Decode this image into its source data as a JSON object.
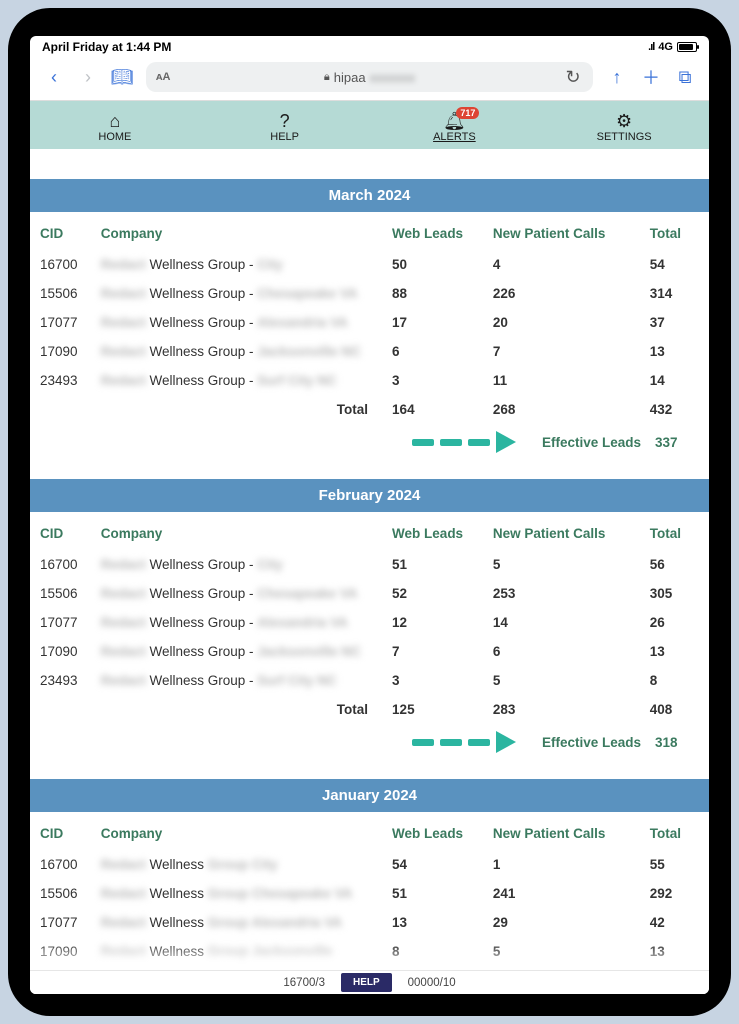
{
  "status": {
    "time": "April Friday at 1:44 PM",
    "carrier": "4G"
  },
  "browser": {
    "domain_visible": "hipaa",
    "domain_blur": "xxxxxxx"
  },
  "nav": {
    "home": "HOME",
    "help": "HELP",
    "alerts": "ALERTS",
    "alerts_badge": "717",
    "settings": "SETTINGS"
  },
  "columns": {
    "cid": "CID",
    "company": "Company",
    "web_leads": "Web Leads",
    "new_patient_calls": "New Patient Calls",
    "total": "Total"
  },
  "labels": {
    "total": "Total",
    "effective": "Effective Leads"
  },
  "months": [
    {
      "title": "March 2024",
      "rows": [
        {
          "cid": "16700",
          "company_blur": "Redact",
          "company": "Wellness Group -",
          "suffix_blur": "City",
          "wl": "50",
          "npc": "4",
          "tot": "54"
        },
        {
          "cid": "15506",
          "company_blur": "Redact",
          "company": "Wellness Group -",
          "suffix_blur": "Chesapeake VA",
          "wl": "88",
          "npc": "226",
          "tot": "314"
        },
        {
          "cid": "17077",
          "company_blur": "Redact",
          "company": "Wellness Group -",
          "suffix_blur": "Alexandria VA",
          "wl": "17",
          "npc": "20",
          "tot": "37"
        },
        {
          "cid": "17090",
          "company_blur": "Redact",
          "company": "Wellness Group -",
          "suffix_blur": "Jacksonville NC",
          "wl": "6",
          "npc": "7",
          "tot": "13"
        },
        {
          "cid": "23493",
          "company_blur": "Redact",
          "company": "Wellness Group -",
          "suffix_blur": "Surf City NC",
          "wl": "3",
          "npc": "11",
          "tot": "14"
        }
      ],
      "totals": {
        "wl": "164",
        "npc": "268",
        "tot": "432"
      },
      "effective": "337"
    },
    {
      "title": "February 2024",
      "rows": [
        {
          "cid": "16700",
          "company_blur": "Redact",
          "company": "Wellness Group -",
          "suffix_blur": "City",
          "wl": "51",
          "npc": "5",
          "tot": "56"
        },
        {
          "cid": "15506",
          "company_blur": "Redact",
          "company": "Wellness Group -",
          "suffix_blur": "Chesapeake VA",
          "wl": "52",
          "npc": "253",
          "tot": "305"
        },
        {
          "cid": "17077",
          "company_blur": "Redact",
          "company": "Wellness Group -",
          "suffix_blur": "Alexandria VA",
          "wl": "12",
          "npc": "14",
          "tot": "26"
        },
        {
          "cid": "17090",
          "company_blur": "Redact",
          "company": "Wellness Group -",
          "suffix_blur": "Jacksonville NC",
          "wl": "7",
          "npc": "6",
          "tot": "13"
        },
        {
          "cid": "23493",
          "company_blur": "Redact",
          "company": "Wellness Group -",
          "suffix_blur": "Surf City NC",
          "wl": "3",
          "npc": "5",
          "tot": "8"
        }
      ],
      "totals": {
        "wl": "125",
        "npc": "283",
        "tot": "408"
      },
      "effective": "318"
    },
    {
      "title": "January 2024",
      "rows": [
        {
          "cid": "16700",
          "company_blur": "Redact",
          "company": "Wellness",
          "suffix_blur": "Group City",
          "wl": "54",
          "npc": "1",
          "tot": "55"
        },
        {
          "cid": "15506",
          "company_blur": "Redact",
          "company": "Wellness",
          "suffix_blur": "Group Chesapeake VA",
          "wl": "51",
          "npc": "241",
          "tot": "292"
        },
        {
          "cid": "17077",
          "company_blur": "Redact",
          "company": "Wellness",
          "suffix_blur": "Group Alexandria VA",
          "wl": "13",
          "npc": "29",
          "tot": "42"
        },
        {
          "cid": "17090",
          "company_blur": "Redact",
          "company": "Wellness",
          "suffix_blur": "Group Jacksonville",
          "wl": "8",
          "npc": "5",
          "tot": "13"
        }
      ],
      "totals": null,
      "effective": null
    }
  ],
  "footer": {
    "left": "16700/3",
    "help": "HELP",
    "right": "00000/10"
  }
}
